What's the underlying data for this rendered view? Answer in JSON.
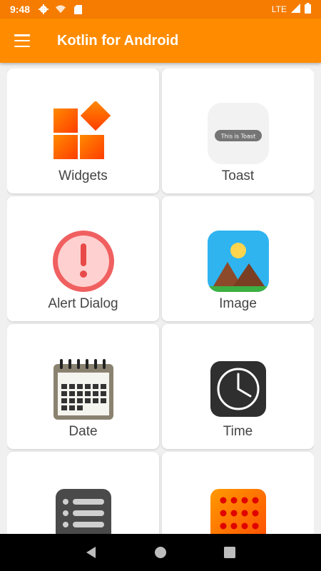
{
  "status_bar": {
    "time": "9:48",
    "network": "LTE",
    "icons": [
      "gear-icon",
      "wifi-icon",
      "sd-card-icon",
      "signal-icon",
      "battery-icon"
    ]
  },
  "app_bar": {
    "title": "Kotlin for Android",
    "menu_icon": "hamburger-menu-icon"
  },
  "colors": {
    "status_bar": "#f57c00",
    "app_bar": "#ff8c00",
    "background": "#f0f0f0"
  },
  "cards": [
    {
      "label": "Widgets",
      "icon": "widgets-icon"
    },
    {
      "label": "Toast",
      "icon": "toast-icon",
      "icon_text": "This is Toast"
    },
    {
      "label": "Alert Dialog",
      "icon": "alert-dialog-icon"
    },
    {
      "label": "Image",
      "icon": "image-icon"
    },
    {
      "label": "Date",
      "icon": "calendar-icon"
    },
    {
      "label": "Time",
      "icon": "clock-icon"
    },
    {
      "label": "",
      "icon": "list-icon"
    },
    {
      "label": "",
      "icon": "grid-dots-icon"
    }
  ],
  "nav_bar": {
    "buttons": [
      "back-icon",
      "home-icon",
      "recents-icon"
    ]
  }
}
